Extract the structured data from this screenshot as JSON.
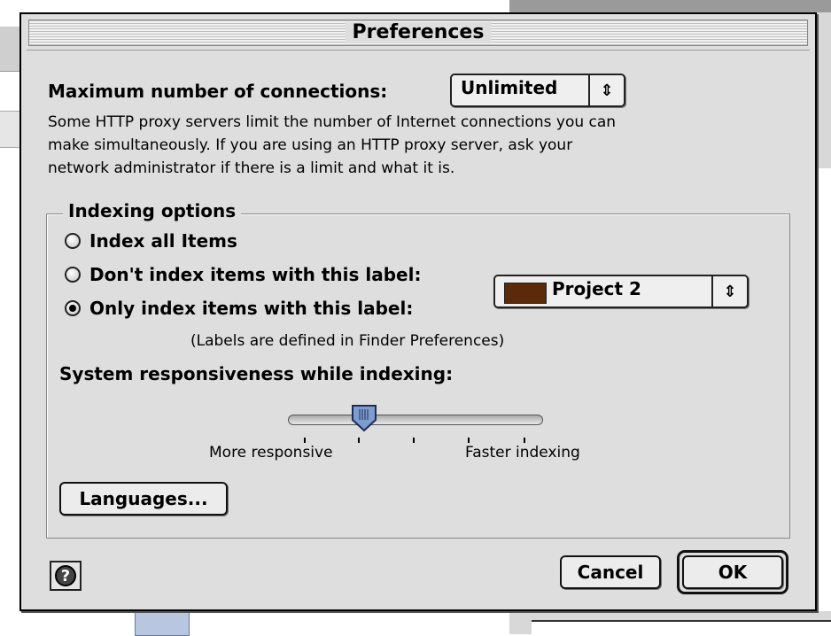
{
  "dialog": {
    "title": "Preferences",
    "connections_label": "Maximum number of connections:",
    "connections_value": "Unlimited",
    "description_lines": [
      "Some HTTP proxy servers limit the number of Internet connections you can",
      "make simultaneously. If you are using an HTTP proxy server, ask your",
      "network administrator if there is a limit and what it is."
    ],
    "indexing": {
      "title": "Indexing options",
      "options": [
        {
          "label": "Index all Items",
          "selected": false
        },
        {
          "label": "Don't index items with this label:",
          "selected": false
        },
        {
          "label": "Only index items with this label:",
          "selected": true
        }
      ],
      "label_popup_value": "Project 2",
      "label_color": "#5a2a0a",
      "labels_note": "(Labels are defined in Finder Preferences)",
      "responsiveness_label": "System responsiveness while indexing:",
      "slider_value": 0.3,
      "slider_min_label": "More responsive",
      "slider_max_label": "Faster indexing",
      "languages_button": "Languages..."
    },
    "buttons": {
      "cancel": "Cancel",
      "ok": "OK"
    },
    "help_icon": "help-icon"
  }
}
